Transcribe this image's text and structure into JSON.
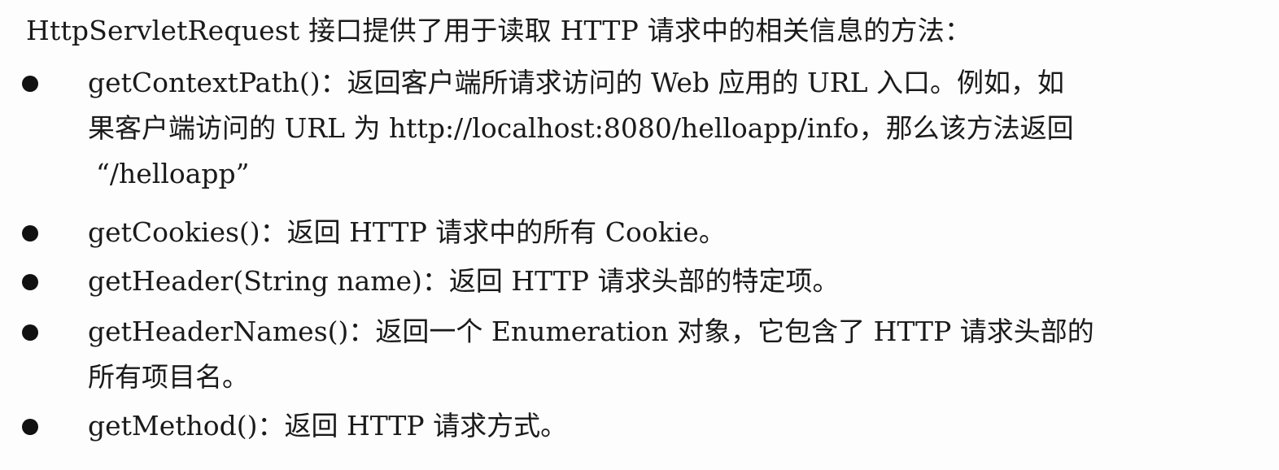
{
  "intro": "HttpServletRequest 接口提供了用于读取 HTTP 请求中的相关信息的方法：",
  "items": [
    {
      "lines": [
        "getContextPath()：返回客户端所请求访问的 Web 应用的 URL 入口。例如，如",
        "果客户端访问的 URL 为 http://localhost:8080/helloapp/info，那么该方法返回",
        "“/helloapp”"
      ]
    },
    {
      "lines": [
        "getCookies()：返回 HTTP 请求中的所有 Cookie。"
      ]
    },
    {
      "lines": [
        "getHeader(String name)：返回 HTTP 请求头部的特定项。"
      ]
    },
    {
      "lines": [
        "getHeaderNames()：返回一个 Enumeration 对象，它包含了 HTTP 请求头部的",
        "所有项目名。"
      ]
    },
    {
      "lines": [
        "getMethod()：返回 HTTP 请求方式。"
      ]
    }
  ]
}
